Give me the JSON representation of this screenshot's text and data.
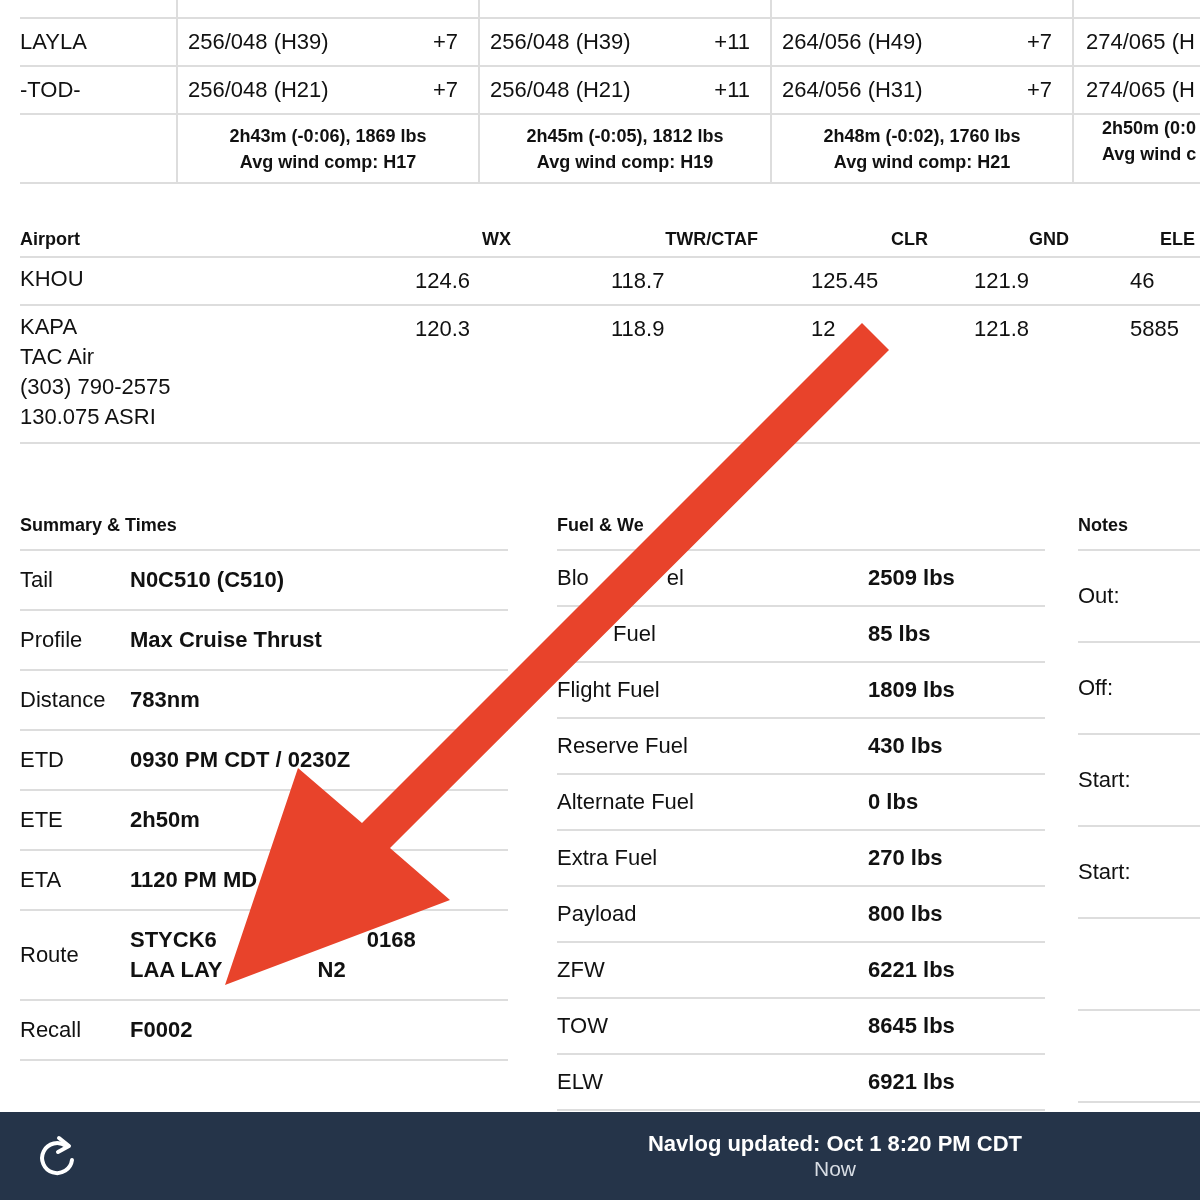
{
  "navlog": {
    "rows": [
      {
        "waypoint": "LAYLA",
        "cells": [
          {
            "wind": "256/048 (H39)",
            "temp": "+7"
          },
          {
            "wind": "256/048 (H39)",
            "temp": "+11"
          },
          {
            "wind": "264/056 (H49)",
            "temp": "+7"
          },
          {
            "wind": "274/065 (H"
          }
        ]
      },
      {
        "waypoint": "-TOD-",
        "cells": [
          {
            "wind": "256/048 (H21)",
            "temp": "+7"
          },
          {
            "wind": "256/048 (H21)",
            "temp": "+11"
          },
          {
            "wind": "264/056 (H31)",
            "temp": "+7"
          },
          {
            "wind": "274/065 (H"
          }
        ]
      }
    ],
    "summaries": [
      [
        "2h43m (-0:06), 1869 lbs",
        "Avg wind comp: H17"
      ],
      [
        "2h45m (-0:05), 1812 lbs",
        "Avg wind comp: H19"
      ],
      [
        "2h48m (-0:02), 1760 lbs",
        "Avg wind comp: H21"
      ],
      [
        "2h50m (0:0",
        "Avg wind c"
      ]
    ]
  },
  "airports": {
    "columns": [
      "Airport",
      "WX",
      "TWR/CTAF",
      "CLR",
      "GND",
      "ELE"
    ],
    "rows": [
      {
        "lines": [
          "KHOU"
        ],
        "values": [
          "124.6",
          "118.7",
          "125.45",
          "121.9",
          "46"
        ]
      },
      {
        "lines": [
          "KAPA",
          "TAC Air",
          "(303) 790-2575",
          "130.075 ASRI"
        ],
        "values": [
          "120.3",
          "118.9",
          "12",
          "121.8",
          "5885"
        ]
      }
    ]
  },
  "summary": {
    "title": "Summary & Times",
    "rows": [
      {
        "label": "Tail",
        "lines": [
          [
            "N0C510 (C510)"
          ]
        ]
      },
      {
        "label": "Profile",
        "lines": [
          [
            "Max Cruise Thrust"
          ]
        ]
      },
      {
        "label": "Distance",
        "lines": [
          [
            "783nm"
          ]
        ]
      },
      {
        "label": "ETD",
        "lines": [
          [
            "0930 PM CDT / 0230Z"
          ]
        ]
      },
      {
        "label": "ETE",
        "lines": [
          [
            "2h50m"
          ]
        ]
      },
      {
        "label": "ETA",
        "lines": [
          [
            "1120 PM MD"
          ]
        ]
      },
      {
        "label": "Route",
        "lines": [
          [
            "STYCK6",
            "0168"
          ],
          [
            "LAA LAY",
            "N2"
          ]
        ]
      },
      {
        "label": "Recall",
        "lines": [
          [
            "F0002"
          ]
        ]
      }
    ]
  },
  "fuel": {
    "title": "Fuel & We",
    "rows": [
      {
        "label": [
          "Blo",
          "el"
        ],
        "covered_start": false,
        "value": "2509 lbs"
      },
      {
        "label": [
          "Fuel"
        ],
        "covered_start": true,
        "value": "85 lbs"
      },
      {
        "label": [
          "Flight Fuel"
        ],
        "covered_start": false,
        "value": "1809 lbs"
      },
      {
        "label": [
          "Reserve Fuel"
        ],
        "covered_start": false,
        "value": "430 lbs"
      },
      {
        "label": [
          "Alternate Fuel"
        ],
        "covered_start": false,
        "value": "0 lbs"
      },
      {
        "label": [
          "Extra Fuel"
        ],
        "covered_start": false,
        "value": "270 lbs"
      },
      {
        "label": [
          "Payload"
        ],
        "covered_start": false,
        "value": "800 lbs"
      },
      {
        "label": [
          "ZFW"
        ],
        "covered_start": false,
        "value": "6221 lbs"
      },
      {
        "label": [
          "TOW"
        ],
        "covered_start": false,
        "value": "8645 lbs"
      },
      {
        "label": [
          "ELW"
        ],
        "covered_start": false,
        "value": "6921 lbs"
      }
    ]
  },
  "notes": {
    "title": "Notes",
    "rows": [
      "Out:",
      "Off:",
      "Start:",
      "Start:"
    ]
  },
  "status_bar": {
    "message": "Navlog updated: Oct 1 8:20 PM CDT",
    "time": "Now"
  }
}
